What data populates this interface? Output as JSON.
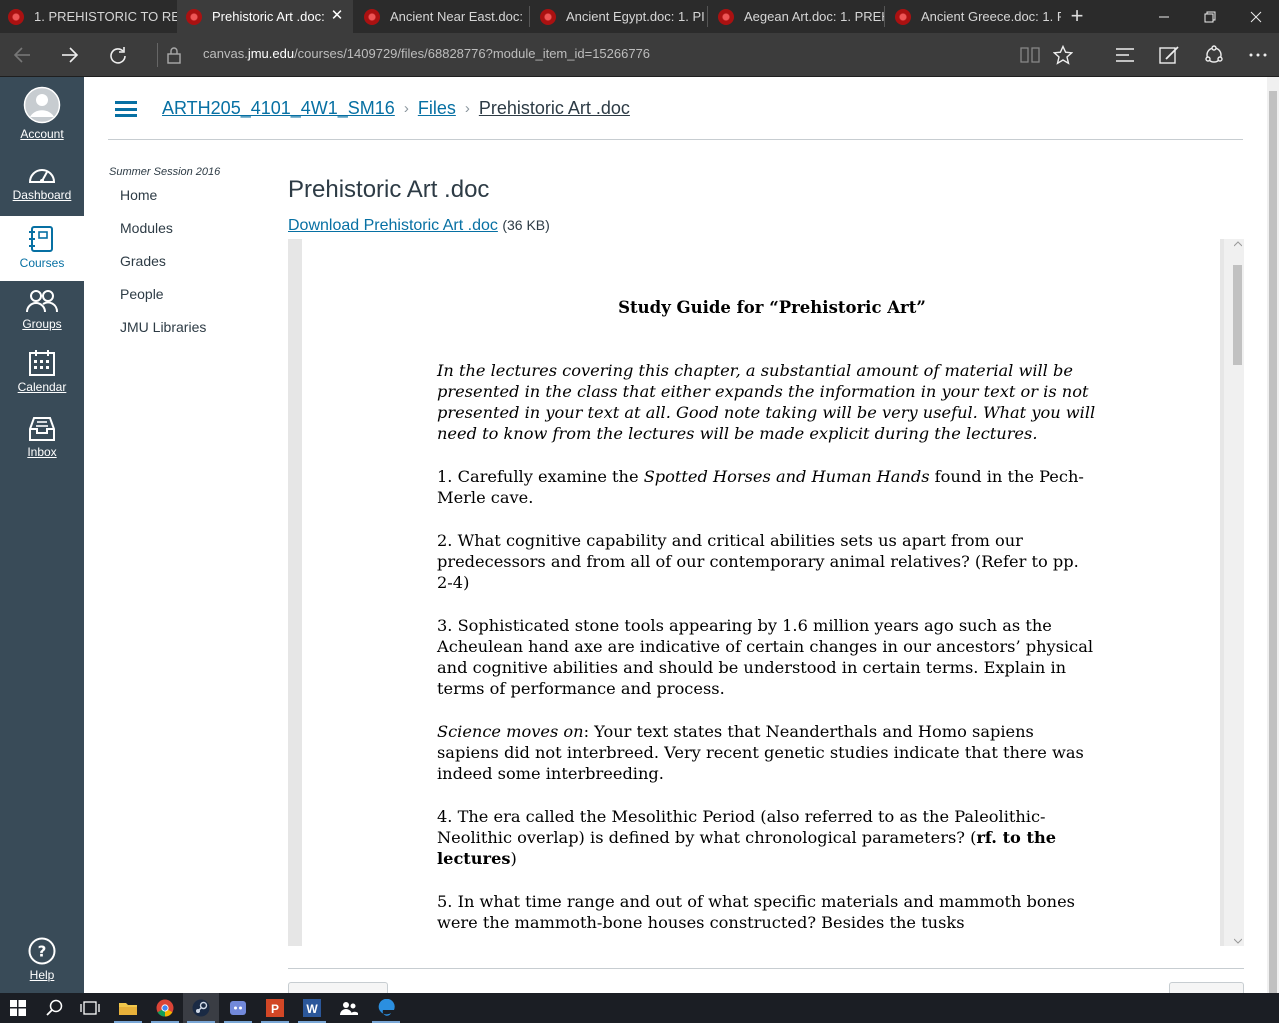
{
  "browser": {
    "tabs": [
      {
        "title": "1. PREHISTORIC TO REN",
        "active": false
      },
      {
        "title": "Prehistoric Art .doc:",
        "active": true
      },
      {
        "title": "Ancient Near East.doc:",
        "active": false
      },
      {
        "title": "Ancient Egypt.doc: 1. PI",
        "active": false
      },
      {
        "title": "Aegean Art.doc: 1. PREH",
        "active": false
      },
      {
        "title": "Ancient Greece.doc: 1. F",
        "active": false
      }
    ],
    "tab_close_glyph": "✕",
    "new_tab_glyph": "+",
    "url_prefix": "canvas.",
    "url_domain": "jmu.edu",
    "url_path": "/courses/1409729/files/68828776?module_item_id=15266776"
  },
  "global_nav": {
    "items": [
      {
        "label": "Account",
        "icon": "account-avatar-icon",
        "active": false
      },
      {
        "label": "Dashboard",
        "icon": "dashboard-icon",
        "active": false
      },
      {
        "label": "Courses",
        "icon": "courses-icon",
        "active": true
      },
      {
        "label": "Groups",
        "icon": "groups-icon",
        "active": false
      },
      {
        "label": "Calendar",
        "icon": "calendar-icon",
        "active": false
      },
      {
        "label": "Inbox",
        "icon": "inbox-icon",
        "active": false
      }
    ],
    "help_label": "Help"
  },
  "breadcrumb": {
    "course": "ARTH205_4101_4W1_SM16",
    "files": "Files",
    "current": "Prehistoric Art .doc"
  },
  "course_nav": {
    "term": "Summer Session 2016",
    "items": [
      "Home",
      "Modules",
      "Grades",
      "People",
      "JMU Libraries"
    ]
  },
  "file": {
    "title": "Prehistoric Art .doc",
    "download_label": "Download Prehistoric Art .doc",
    "size": "(36 KB)"
  },
  "document": {
    "heading": "Study Guide for “Prehistoric Art”",
    "intro": "In the lectures covering this chapter, a substantial amount of material will be presented in the class that either expands the information in your text or is not presented in your text at all. Good note taking will be very useful. What you will need to know from the lectures will be made explicit during the lectures.",
    "q1_pre": "1. Carefully examine the ",
    "q1_italic": "Spotted Horses and Human Hands",
    "q1_post": " found in the Pech-Merle cave.",
    "q2": "2. What cognitive capability and critical abilities sets us apart from our predecessors and from all of our contemporary animal relatives? (Refer to pp. 2-4)",
    "q3": "3. Sophisticated stone tools appearing by 1.6 million years ago such as the Acheulean hand axe are indicative of certain changes in our ancestors’ physical and cognitive abilities and should be understood in certain terms. Explain in terms of performance and process.",
    "science_italic": "Science moves on",
    "science_text": ": Your text states that Neanderthals and Homo sapiens sapiens did not interbreed. Very recent genetic studies indicate that there was indeed some interbreeding.",
    "q4_pre": "4. The era called the Mesolithic Period (also referred to as the Paleolithic-Neolithic overlap) is defined by what chronological parameters? (",
    "q4_bold": "rf. to the lectures",
    "q4_post": ")",
    "q5": "5. In what time range and out of what specific materials and mammoth bones were the mammoth-bone houses constructed? Besides the tusks"
  },
  "colors": {
    "nav_bg": "#394b58",
    "link": "#0770a3",
    "text": "#2d3b45"
  }
}
